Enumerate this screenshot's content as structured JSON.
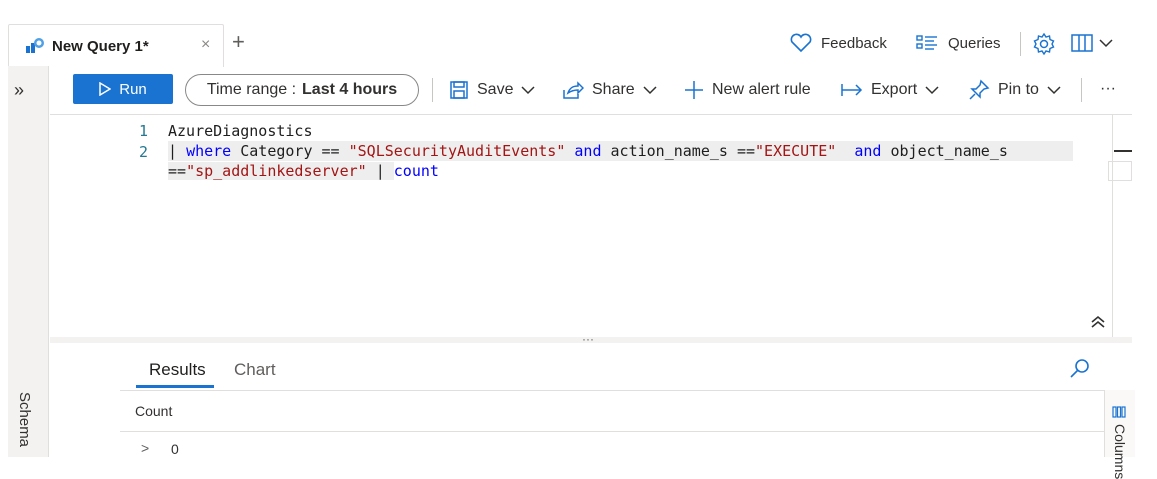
{
  "tab": {
    "title": "New Query 1*",
    "close": "×",
    "add": "+"
  },
  "header": {
    "feedback": "Feedback",
    "queries": "Queries"
  },
  "sidebar": {
    "expand": "»",
    "schema": "Schema"
  },
  "toolbar": {
    "run": "Run",
    "time_range_label": "Time range :",
    "time_range_value": "Last 4 hours",
    "save": "Save",
    "share": "Share",
    "new_alert_rule": "New alert rule",
    "export": "Export",
    "pin_to": "Pin to",
    "more": "···"
  },
  "editor": {
    "line_numbers": [
      "1",
      "2"
    ],
    "line1": "AzureDiagnostics",
    "line2": {
      "pipe": "| ",
      "where": "where",
      "t1": " Category == ",
      "s1": "\"SQLSecurityAuditEvents\"",
      "sp1": " ",
      "and1": "and",
      "t2": " action_name_s ==",
      "s2": "\"EXECUTE\"",
      "sp2": "  ",
      "and2": "and",
      "t3": " object_name_s"
    },
    "line3": {
      "t1": "==",
      "s1": "\"sp_addlinkedserver\"",
      "t2": " | ",
      "count": "count"
    },
    "splitter_dots": "···",
    "collapse": "«"
  },
  "results": {
    "tabs": [
      "Results",
      "Chart"
    ],
    "columns": [
      "Count"
    ],
    "rows": [
      [
        "0"
      ]
    ],
    "row_expand": ">",
    "right_panel": "Columns"
  },
  "colors": {
    "accent": "#1a73d1",
    "keyword": "#0000ff",
    "string": "#a31515",
    "linenum": "#237893"
  }
}
